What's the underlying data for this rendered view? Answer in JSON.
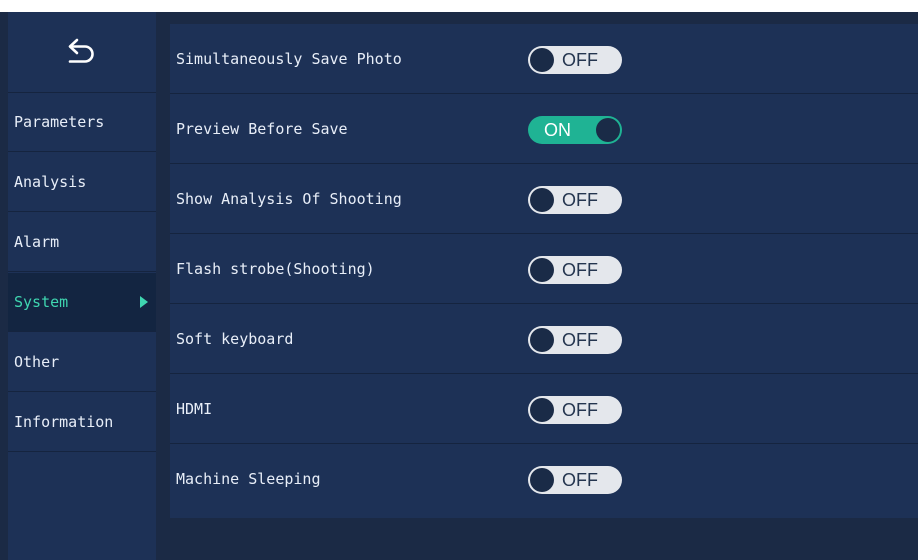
{
  "sidebar": {
    "items": [
      {
        "label": "Parameters",
        "active": false
      },
      {
        "label": "Analysis",
        "active": false
      },
      {
        "label": "Alarm",
        "active": false
      },
      {
        "label": "System",
        "active": true
      },
      {
        "label": "Other",
        "active": false
      },
      {
        "label": "Information",
        "active": false
      }
    ]
  },
  "settings": {
    "rows": [
      {
        "label": "Simultaneously Save Photo",
        "state": "OFF"
      },
      {
        "label": "Preview Before Save",
        "state": "ON"
      },
      {
        "label": "Show Analysis Of Shooting",
        "state": "OFF"
      },
      {
        "label": "Flash strobe(Shooting)",
        "state": "OFF"
      },
      {
        "label": "Soft keyboard",
        "state": "OFF"
      },
      {
        "label": "HDMI",
        "state": "OFF"
      },
      {
        "label": "Machine Sleeping",
        "state": "OFF"
      }
    ]
  },
  "colors": {
    "background": "#1b2a45",
    "panel": "#1d3156",
    "accent": "#3fd6b0",
    "toggle_on": "#1fb394",
    "toggle_off": "#e4e7ec"
  },
  "icons": {
    "back": "back-arrow-icon",
    "active_marker": "triangle-right-icon"
  }
}
